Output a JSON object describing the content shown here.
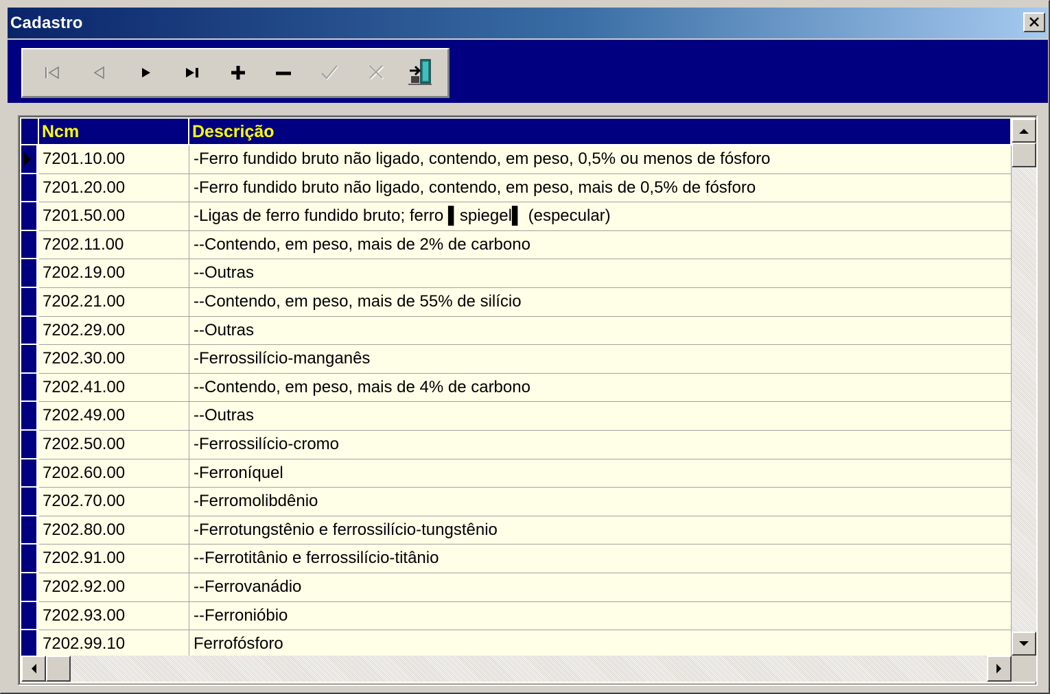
{
  "window": {
    "title": "Cadastro"
  },
  "toolbar": {
    "buttons": [
      {
        "name": "first-record",
        "icon": "first-record-icon",
        "enabled": false
      },
      {
        "name": "prior-record",
        "icon": "prior-record-icon",
        "enabled": false
      },
      {
        "name": "next-record",
        "icon": "next-record-icon",
        "enabled": true
      },
      {
        "name": "last-record",
        "icon": "last-record-icon",
        "enabled": true
      },
      {
        "name": "insert-record",
        "icon": "plus-icon",
        "enabled": true
      },
      {
        "name": "delete-record",
        "icon": "minus-icon",
        "enabled": true
      },
      {
        "name": "post-edit",
        "icon": "check-icon",
        "enabled": false
      },
      {
        "name": "cancel-edit",
        "icon": "x-icon",
        "enabled": false
      },
      {
        "name": "exit",
        "icon": "exit-door-icon",
        "enabled": true
      }
    ]
  },
  "grid": {
    "columns": [
      "Ncm",
      "Descrição"
    ],
    "current_row": 0,
    "rows": [
      {
        "ncm": "7201.10.00",
        "descricao": "-Ferro fundido bruto não ligado, contendo, em peso, 0,5% ou menos de fósforo"
      },
      {
        "ncm": "7201.20.00",
        "descricao": "-Ferro fundido bruto não ligado, contendo, em peso, mais de 0,5% de fósforo"
      },
      {
        "ncm": "7201.50.00",
        "descricao": "-Ligas de ferro fundido bruto; ferro ▌spiegel▌ (especular)"
      },
      {
        "ncm": "7202.11.00",
        "descricao": "--Contendo, em peso, mais de 2% de carbono"
      },
      {
        "ncm": "7202.19.00",
        "descricao": "--Outras"
      },
      {
        "ncm": "7202.21.00",
        "descricao": "--Contendo, em peso, mais de 55% de silício"
      },
      {
        "ncm": "7202.29.00",
        "descricao": "--Outras"
      },
      {
        "ncm": "7202.30.00",
        "descricao": "-Ferrossilício-manganês"
      },
      {
        "ncm": "7202.41.00",
        "descricao": "--Contendo, em peso, mais de 4% de carbono"
      },
      {
        "ncm": "7202.49.00",
        "descricao": "--Outras"
      },
      {
        "ncm": "7202.50.00",
        "descricao": "-Ferrossilício-cromo"
      },
      {
        "ncm": "7202.60.00",
        "descricao": "-Ferroníquel"
      },
      {
        "ncm": "7202.70.00",
        "descricao": "-Ferromolibdênio"
      },
      {
        "ncm": "7202.80.00",
        "descricao": "-Ferrotungstênio e ferrossilício-tungstênio"
      },
      {
        "ncm": "7202.91.00",
        "descricao": "--Ferrotitânio e ferrossilício-titânio"
      },
      {
        "ncm": "7202.92.00",
        "descricao": "--Ferrovanádio"
      },
      {
        "ncm": "7202.93.00",
        "descricao": "--Ferronióbio"
      },
      {
        "ncm": "7202.99.10",
        "descricao": "Ferrofósforo"
      }
    ]
  }
}
